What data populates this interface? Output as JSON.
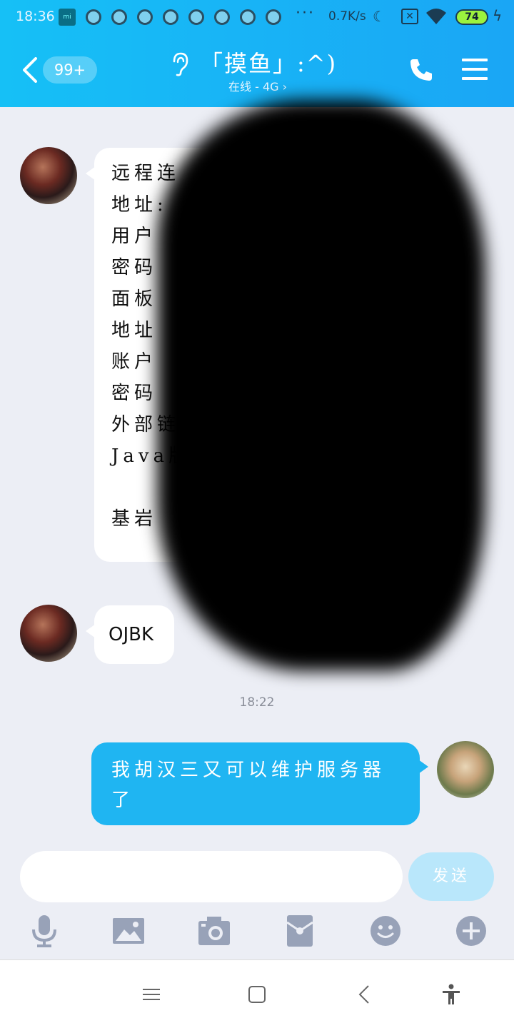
{
  "status_bar": {
    "time": "18:36",
    "network_speed": "0.7K/s",
    "battery": "74"
  },
  "header": {
    "unread_badge": "99+",
    "title": "「摸鱼」:^)",
    "subtitle": "在线 - 4G ›"
  },
  "messages": {
    "received_1_lines": [
      "远程连",
      "地址:",
      "用户",
      "密码",
      "面板",
      "地址",
      "账户",
      "密码",
      "外部链",
      "Java版",
      "",
      "基岩"
    ],
    "received_2": "OJBK",
    "timestamp": "18:22",
    "sent_1": "我胡汉三又可以维护服务器了"
  },
  "composer": {
    "input_value": "",
    "send_label": "发送"
  },
  "colors": {
    "header_gradient_start": "#16c0f6",
    "header_gradient_end": "#1aa6f5",
    "sent_bubble": "#1fb5f2",
    "send_button_disabled": "#b9e7fb",
    "background": "#eceef5"
  },
  "icons": {
    "toolbar": [
      "microphone-icon",
      "image-icon",
      "camera-icon",
      "red-packet-icon",
      "emoji-icon",
      "plus-icon"
    ],
    "navbar": [
      "menu-icon",
      "home-icon",
      "back-icon",
      "accessibility-icon"
    ]
  }
}
